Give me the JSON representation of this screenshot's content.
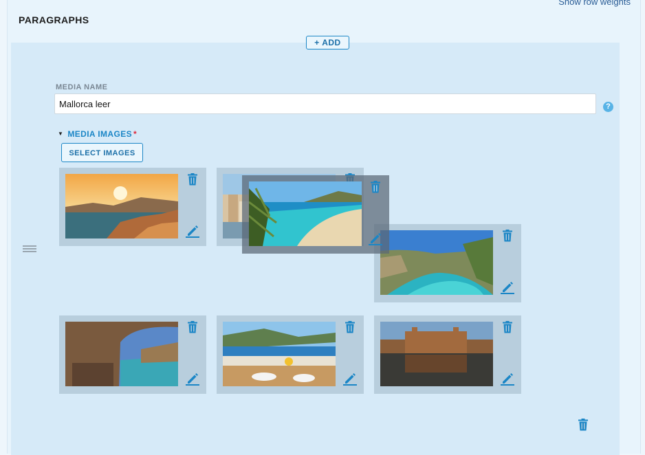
{
  "header": {
    "row_weights_link": "Show row weights",
    "section_title": "PARAGRAPHS",
    "add_button": "+ ADD"
  },
  "form": {
    "media_name_label": "MEDIA NAME",
    "media_name_value": "Mallorca leer",
    "help_glyph": "?",
    "media_images_label": "MEDIA IMAGES",
    "required_marker": "*",
    "select_images_button": "SELECT IMAGES"
  },
  "tiles": [
    {
      "name": "sunset-coast",
      "icons": [
        "trash-icon",
        "edit-pencil-icon"
      ]
    },
    {
      "name": "old-town-harbour",
      "icons": [
        "trash-icon",
        "edit-pencil-icon"
      ]
    },
    {
      "name": "cove-cliffs",
      "icons": [
        "trash-icon",
        "edit-pencil-icon"
      ]
    },
    {
      "name": "stone-arch-bay",
      "icons": [
        "trash-icon",
        "edit-pencil-icon"
      ]
    },
    {
      "name": "terrace-lunch",
      "icons": [
        "trash-icon",
        "edit-pencil-icon"
      ]
    },
    {
      "name": "cathedral-reflection",
      "icons": [
        "trash-icon",
        "edit-pencil-icon"
      ]
    }
  ],
  "dragging": {
    "name": "beach-palm",
    "icons": [
      "trash-icon",
      "edit-pencil-icon"
    ]
  },
  "colors": {
    "accent": "#1b86c6",
    "panel": "#d6eaf8",
    "tile": "#b8cedd",
    "required": "#e0283a"
  }
}
